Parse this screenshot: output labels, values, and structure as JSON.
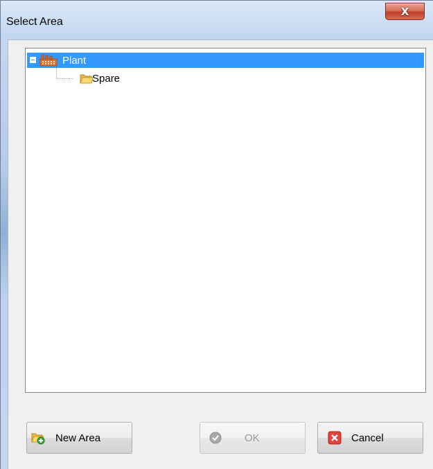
{
  "window": {
    "title": "Select Area",
    "close_glyph": "X"
  },
  "tree": {
    "root": {
      "label": "Plant",
      "icon": "factory-icon",
      "selected": true,
      "expanded": true
    },
    "children": [
      {
        "label": "Spare",
        "icon": "folder-icon"
      }
    ]
  },
  "buttons": {
    "new_area": {
      "label": "New Area",
      "icon": "new-folder-icon",
      "enabled": true
    },
    "ok": {
      "label": "OK",
      "icon": "check-icon",
      "enabled": false
    },
    "cancel": {
      "label": "Cancel",
      "icon": "cancel-x-icon",
      "enabled": true
    }
  },
  "colors": {
    "selection": "#3399ff",
    "close_button": "#c0402a"
  }
}
